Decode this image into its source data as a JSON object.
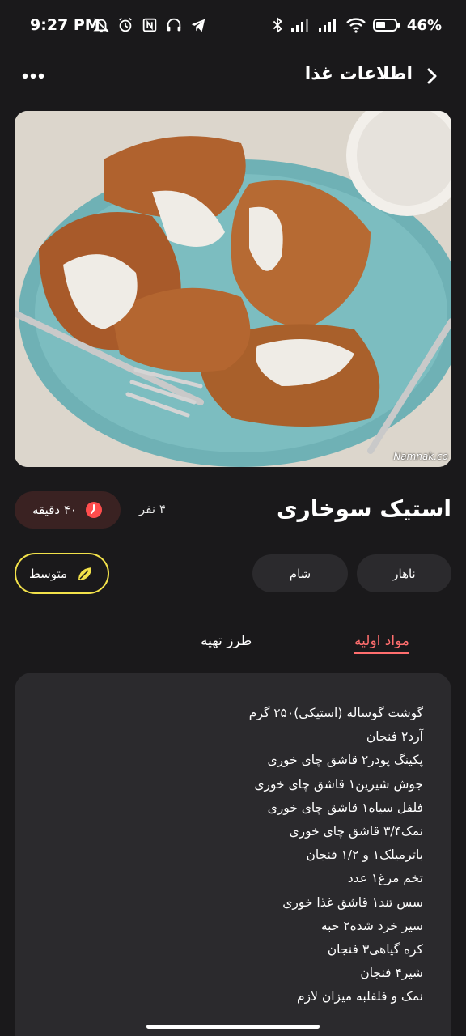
{
  "status_bar": {
    "time": "9:27 PM",
    "battery": "46%",
    "icons": [
      "mute-bell-icon",
      "alarm-icon",
      "nfc-icon",
      "headset-icon",
      "telegram-icon",
      "bluetooth-icon",
      "signal-icon",
      "signal-icon",
      "wifi-icon",
      "battery-icon"
    ]
  },
  "header": {
    "title": "اطلاعات غذا",
    "back_icon": "chevron-right-icon",
    "more_icon": "more-dots-icon"
  },
  "hero": {
    "watermark": "Namnak.co"
  },
  "dish": {
    "title": "استیک سوخاری",
    "servings": "۴ نفر",
    "time": "۴۰ دقیقه",
    "time_color": "#ff4d4d"
  },
  "tags": {
    "lunch": "ناهار",
    "dinner": "شام",
    "difficulty": "متوسط",
    "difficulty_color": "#f2e14a"
  },
  "tabs": {
    "ingredients": "مواد اولیه",
    "preparation": "طرز تهیه",
    "active_color": "#ff6e6e"
  },
  "ingredients": [
    "گوشت گوساله (استیکی)۲۵۰ گرم",
    "آرد۲ فنجان",
    "پکینگ پودر۲ قاشق چای خوری",
    "جوش شیرین۱ قاشق چای خوری",
    "فلفل سیاه۱ قاشق چای خوری",
    "نمک۳/۴ قاشق چای خوری",
    "باترمیلک۱ و ۱/۲ فنجان",
    "تخم مرغ۱ عدد",
    "سس تند۱ قاشق غذا خوری",
    "سیر خرد شده۲ حبه",
    "کره گیاهی۳ فنجان",
    "شیر۴ فنجان",
    "نمک و فلفلبه میزان لازم"
  ]
}
